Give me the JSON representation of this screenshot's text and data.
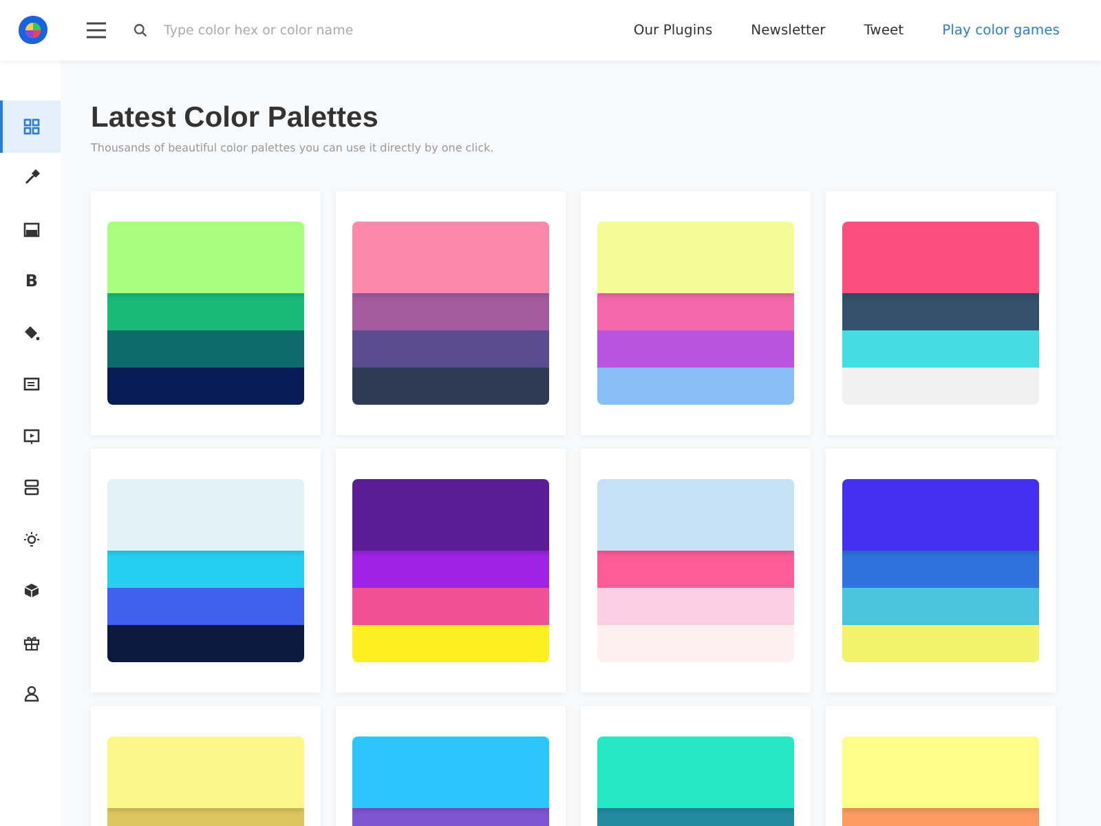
{
  "search": {
    "placeholder": "Type color hex or color name"
  },
  "nav": [
    {
      "label": "Our Plugins",
      "accent": false
    },
    {
      "label": "Newsletter",
      "accent": false
    },
    {
      "label": "Tweet",
      "accent": false
    },
    {
      "label": "Play color games",
      "accent": true
    }
  ],
  "sidebar": {
    "items": [
      {
        "kind": "grid",
        "selected": true
      },
      {
        "kind": "dropper",
        "selected": false
      },
      {
        "kind": "image",
        "selected": false
      },
      {
        "kind": "letter",
        "label": "B",
        "selected": false
      },
      {
        "kind": "bucket",
        "selected": false
      },
      {
        "kind": "news",
        "selected": false
      },
      {
        "kind": "play",
        "selected": false
      },
      {
        "kind": "rows",
        "selected": false
      },
      {
        "kind": "bulb",
        "selected": false
      },
      {
        "kind": "cube",
        "selected": false
      },
      {
        "kind": "gift",
        "selected": false
      },
      {
        "kind": "user",
        "selected": false
      }
    ]
  },
  "title": "Latest Color Palettes",
  "subtitle": "Thousands of beautiful color palettes you can use it directly by one click.",
  "palettes": [
    {
      "swatches": [
        {
          "color": "#a6fd7e"
        },
        {
          "color": "#19b978"
        },
        {
          "color": "#0d6b6e"
        },
        {
          "color": "#0a1c55"
        }
      ]
    },
    {
      "swatches": [
        {
          "color": "#fd88ae"
        },
        {
          "color": "#a35b9d"
        },
        {
          "color": "#584c8e"
        },
        {
          "color": "#2f3a55"
        }
      ]
    },
    {
      "swatches": [
        {
          "color": "#f5fb97"
        },
        {
          "color": "#f467ab"
        },
        {
          "color": "#b954de"
        },
        {
          "color": "#89bdf5"
        }
      ]
    },
    {
      "swatches": [
        {
          "color": "#fd4f7f"
        },
        {
          "color": "#34506a"
        },
        {
          "color": "#44dde4"
        },
        {
          "color": "#f0f0f0"
        }
      ]
    },
    {
      "swatches": [
        {
          "color": "#e2f1f5"
        },
        {
          "color": "#26cff1"
        },
        {
          "color": "#4060f0"
        },
        {
          "color": "#0d1a3f"
        }
      ]
    },
    {
      "swatches": [
        {
          "color": "#5a1d96"
        },
        {
          "color": "#9f22e4"
        },
        {
          "color": "#f05194"
        },
        {
          "color": "#fcee21"
        }
      ]
    },
    {
      "swatches": [
        {
          "color": "#c4e1f5"
        },
        {
          "color": "#fd5c97"
        },
        {
          "color": "#fccee3"
        },
        {
          "color": "#fdf0f0"
        }
      ]
    },
    {
      "swatches": [
        {
          "color": "#4530f2"
        },
        {
          "color": "#2d72dd"
        },
        {
          "color": "#48c5dc"
        },
        {
          "color": "#f2f36b"
        }
      ]
    },
    {
      "swatches": [
        {
          "color": "#fdf78a"
        },
        {
          "color": "#dcc55c"
        }
      ]
    },
    {
      "swatches": [
        {
          "color": "#2bc6fb"
        },
        {
          "color": "#7d55d3"
        }
      ]
    },
    {
      "swatches": [
        {
          "color": "#25e8c5"
        },
        {
          "color": "#238aa0"
        }
      ]
    },
    {
      "swatches": [
        {
          "color": "#fdfd88"
        },
        {
          "color": "#fd9a5f"
        }
      ]
    }
  ]
}
